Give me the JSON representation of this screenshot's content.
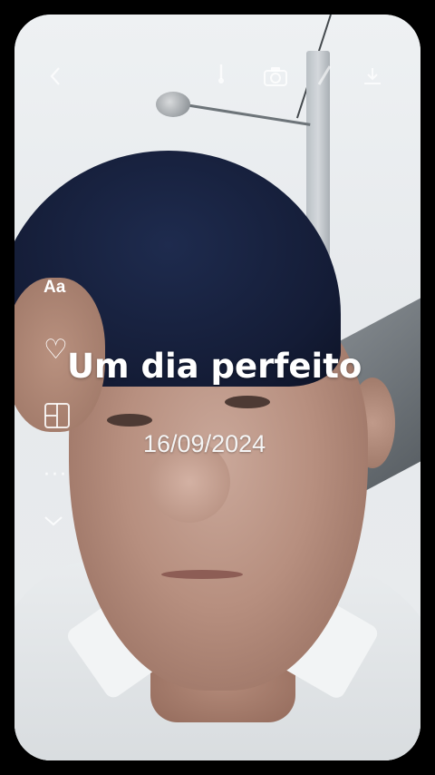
{
  "story": {
    "title": "Um dia perfeito",
    "date": "16/09/2024"
  },
  "toolbar": {
    "back_icon": "chevron-left-icon",
    "icons": [
      "music-icon",
      "camera-icon",
      "sticker-icon",
      "download-icon"
    ]
  },
  "side_tools": {
    "text_label": "Aa",
    "heart_icon": "heart-outline-icon",
    "template_icon": "layout-icon",
    "more_label": "···",
    "expand_icon": "chevron-down-icon"
  }
}
